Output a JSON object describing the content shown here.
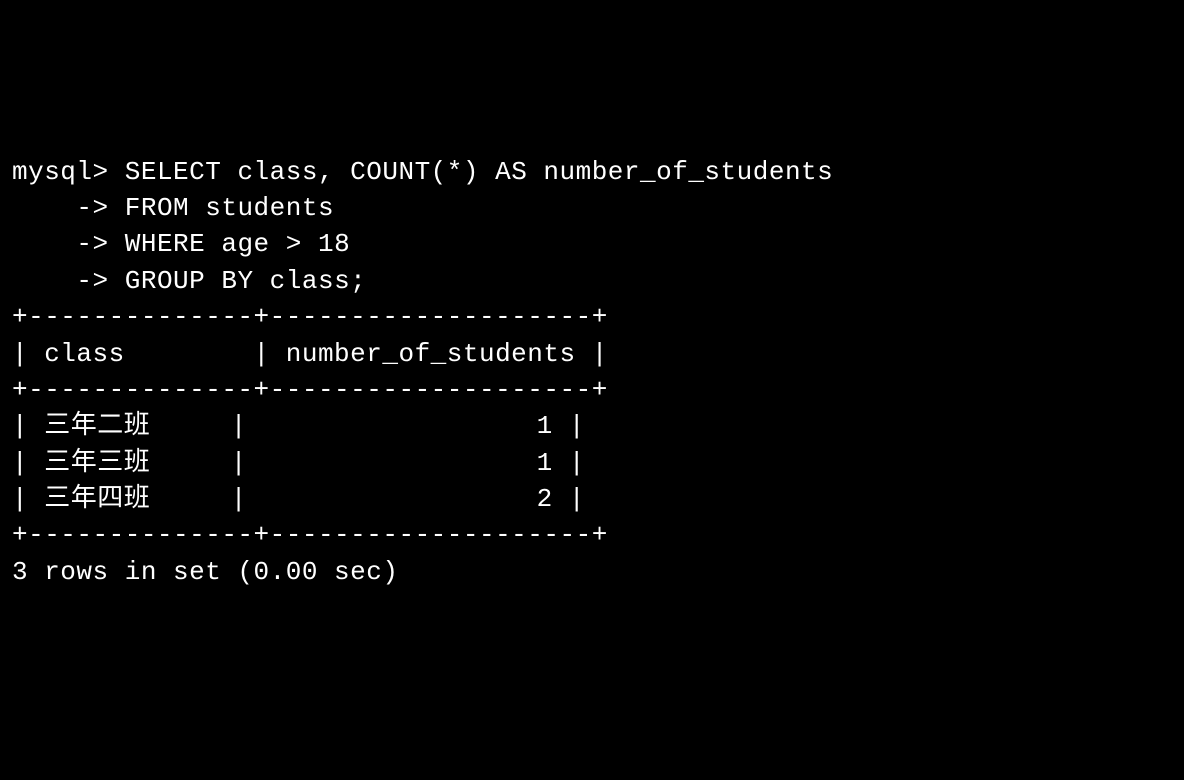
{
  "prompt": "mysql>",
  "continuation": "    ->",
  "query": {
    "line1": "SELECT class, COUNT(*) AS number_of_students",
    "line2": "FROM students",
    "line3": "WHERE age > 18",
    "line4": "GROUP BY class;"
  },
  "table": {
    "border_top": "+--------------+--------------------+",
    "header": "| class        | number_of_students |",
    "border_mid": "+--------------+--------------------+",
    "rows": [
      {
        "class": "三年二班",
        "count": 1,
        "line": "| 三年二班     |                  1 |"
      },
      {
        "class": "三年三班",
        "count": 1,
        "line": "| 三年三班     |                  1 |"
      },
      {
        "class": "三年四班",
        "count": 2,
        "line": "| 三年四班     |                  2 |"
      }
    ],
    "border_bot": "+--------------+--------------------+"
  },
  "status": "3 rows in set (0.00 sec)",
  "chart_data": {
    "type": "table",
    "columns": [
      "class",
      "number_of_students"
    ],
    "data": [
      [
        "三年二班",
        1
      ],
      [
        "三年三班",
        1
      ],
      [
        "三年四班",
        2
      ]
    ]
  }
}
